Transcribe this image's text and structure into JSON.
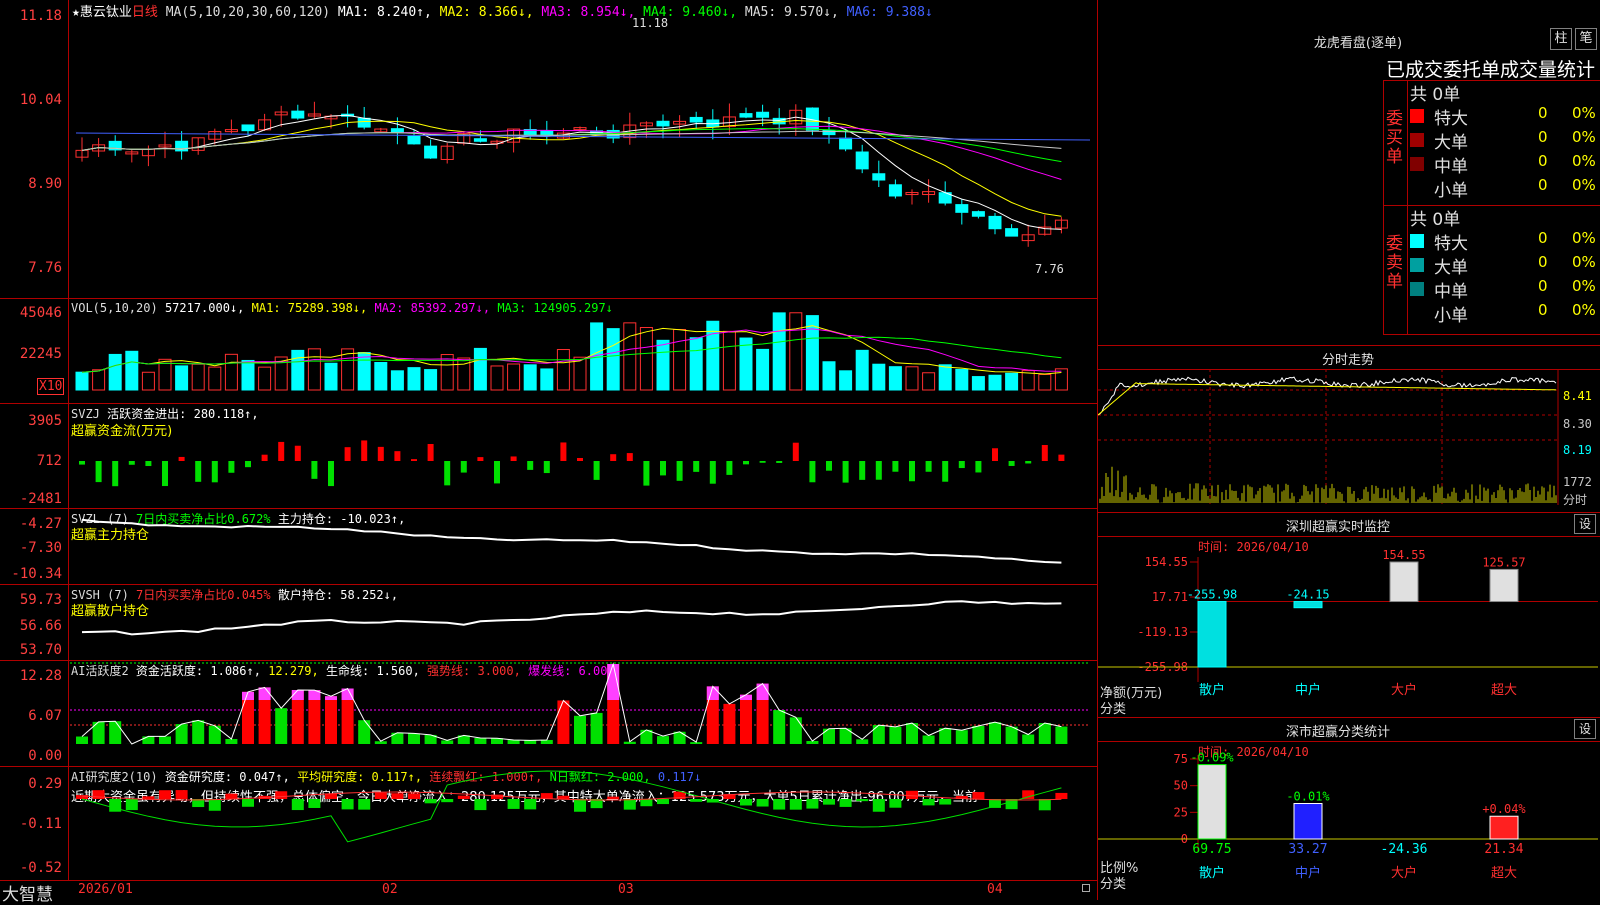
{
  "stock": {
    "star": "★",
    "name": "惠云钛业",
    "period": "日线"
  },
  "main_header": {
    "ma": "MA(5,10,20,30,60,120)",
    "ma1": "MA1: 8.240↑,",
    "ma2": "MA2: 8.366↓,",
    "ma3": "MA3: 8.954↓,",
    "ma4": "MA4: 9.460↓,",
    "ma5": "MA5: 9.570↓,",
    "ma6": "MA6: 9.388↓"
  },
  "main_axis": [
    "11.18",
    "10.04",
    "8.90",
    "7.76"
  ],
  "main_annotations": {
    "high": "11.18",
    "low": "7.76"
  },
  "vol_header": {
    "name": "VOL(5,10,20)",
    "v": "57217.000↓,",
    "ma1": "MA1: 75289.398↓,",
    "ma2": "MA2: 85392.297↓,",
    "ma3": "MA3: 124905.297↓"
  },
  "vol_axis": [
    "45046",
    "22245"
  ],
  "vol_unit": "X10",
  "svzj_header": {
    "name": "SVZJ",
    "label": "活跃资金进出: 280.118↑,",
    "sub": "超赢资金流(万元)"
  },
  "svzj_axis": [
    "3905",
    "712",
    "-2481"
  ],
  "svzl_header": {
    "name": "SVZL (7)",
    "label1": "7日内买卖净占比0.672%",
    "label2": "主力持仓: -10.023↑,",
    "sub": "超赢主力持仓"
  },
  "svzl_axis": [
    "-4.27",
    "-7.30",
    "-10.34"
  ],
  "svsh_header": {
    "name": "SVSH (7)",
    "label1": "7日内买卖净占比0.045%",
    "label2": "散户持仓: 58.252↓,",
    "sub": "超赢散户持仓"
  },
  "svsh_axis": [
    "59.73",
    "56.66",
    "53.70"
  ],
  "ai_active_header": {
    "name": "AI活跃度2",
    "label": "资金活跃度: 1.086↑,",
    "v2": "12.279,",
    "life": "生命线: 1.560,",
    "strong": "强势线: 3.000,",
    "burst": "爆发线: 6.000,"
  },
  "ai_active_axis": [
    "12.28",
    "6.07",
    "0.00"
  ],
  "ai_research_header": {
    "name": "AI研究度2(10)",
    "label": "资金研究度: 0.047↑,",
    "avg": "平均研究度: 0.117↑,",
    "cont": "连续飘红: 1.000↑,",
    "nday": "N日飘红: 2.000,",
    "last": "0.117↓"
  },
  "ai_research_axis": [
    "0.29",
    "-0.11",
    "-0.52"
  ],
  "comment": "近期大资金虽有异动，但持续性不强，总体偏空，今日大单净流入：280.125万元，其中特大单净流入：125.573万元，大单5日累计净出-96.007万元，当前",
  "bottom": {
    "logo": "大智慧",
    "dates": [
      "2026/01",
      "02",
      "03",
      "04"
    ]
  },
  "dragon": {
    "title": "龙虎看盘(逐单)",
    "tab1": "柱",
    "tab2": "笔",
    "subtitle": "已成交委托单成交量统计",
    "buy_label": "委买单",
    "sell_label": "委卖单",
    "buy_total": "共 0单",
    "sell_total": "共 0单",
    "buy_rows": [
      {
        "name": "特大",
        "count": "0",
        "pct": "0%",
        "color": "#ff0000"
      },
      {
        "name": "大单",
        "count": "0",
        "pct": "0%",
        "color": "#a00000"
      },
      {
        "name": "中单",
        "count": "0",
        "pct": "0%",
        "color": "#800000"
      },
      {
        "name": "小单",
        "count": "0",
        "pct": "0%",
        "color": ""
      }
    ],
    "sell_rows": [
      {
        "name": "特大",
        "count": "0",
        "pct": "0%",
        "color": "#00ffff"
      },
      {
        "name": "大单",
        "count": "0",
        "pct": "0%",
        "color": "#00a0a0"
      },
      {
        "name": "中单",
        "count": "0",
        "pct": "0%",
        "color": "#008080"
      },
      {
        "name": "小单",
        "count": "0",
        "pct": "0%",
        "color": ""
      }
    ]
  },
  "intraday": {
    "title": "分时走势",
    "axis": [
      "8.41",
      "8.30",
      "8.19"
    ],
    "vol": "1772",
    "vol_label": "分时"
  },
  "sz_monitor": {
    "title": "深圳超赢实时监控",
    "set": "设",
    "time": "时间: 2026/04/10",
    "axis": [
      "154.55",
      "17.71",
      "-119.13",
      "-255.98"
    ],
    "ylabel": "净额(万元)",
    "xlabel": "分类",
    "categories": [
      "散户",
      "中户",
      "大户",
      "超大"
    ],
    "values": [
      -255.98,
      -24.15,
      154.55,
      125.57
    ],
    "value_labels": [
      "-255.98",
      "-24.15",
      "154.55",
      "125.57"
    ]
  },
  "sz_class": {
    "title": "深市超赢分类统计",
    "set": "设",
    "time": "时间: 2026/04/10",
    "axis": [
      "75",
      "50",
      "25",
      "0"
    ],
    "ylabel": "比例%",
    "xlabel": "分类",
    "categories": [
      "散户",
      "中户",
      "大户",
      "超大"
    ],
    "values": [
      69.75,
      33.27,
      -24.36,
      21.34
    ],
    "value_labels": [
      "69.75",
      "33.27",
      "-24.36",
      "21.34"
    ],
    "change_labels": [
      "-0.09%",
      "-0.01%",
      "",
      "+0.04%"
    ]
  },
  "colors": {
    "up": "#ff3030",
    "down": "#00ffff",
    "red_border": "#b00000"
  },
  "chart_data": {
    "type": "bar",
    "title": "深圳超赢实时监控",
    "categories": [
      "散户",
      "中户",
      "大户",
      "超大"
    ],
    "values": [
      -255.98,
      -24.15,
      154.55,
      125.57
    ],
    "ylabel": "净额(万元)",
    "xlabel": "分类"
  }
}
